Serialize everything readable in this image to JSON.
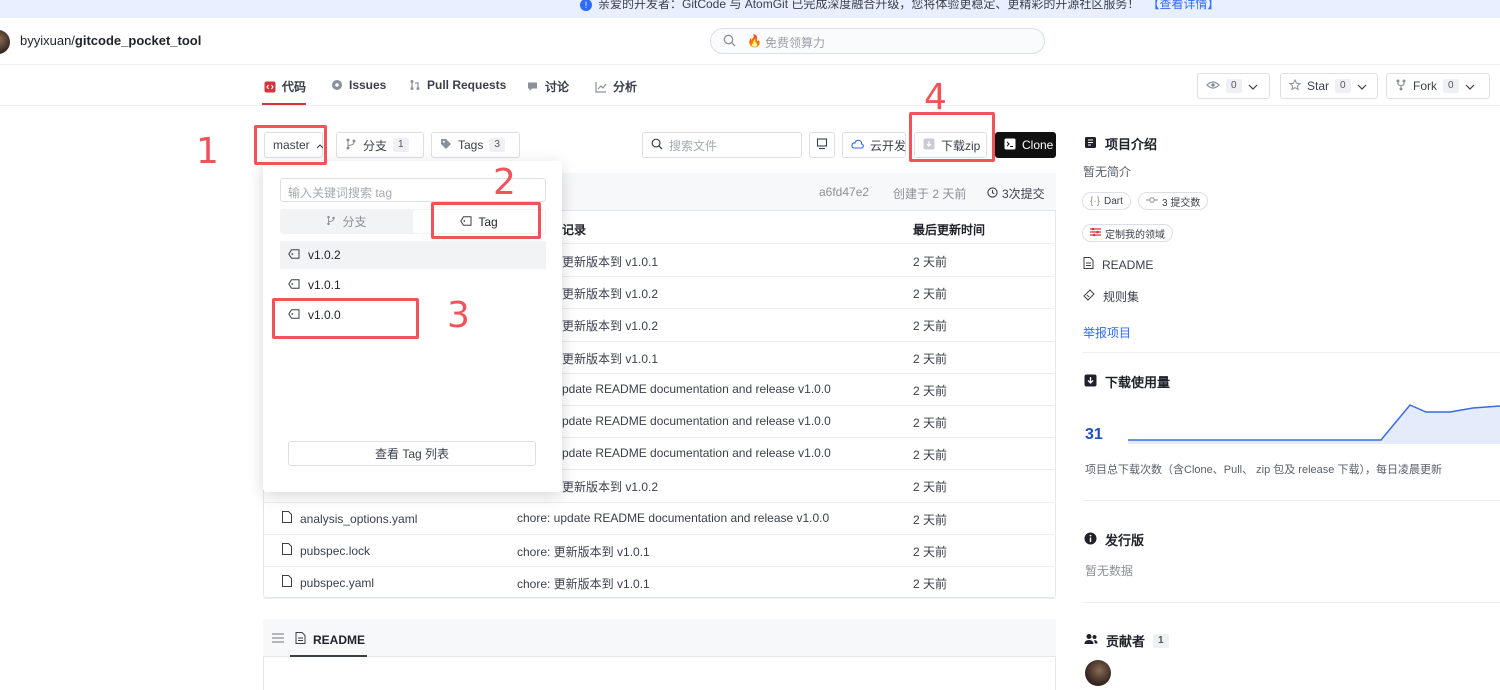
{
  "banner": {
    "text": "亲爱的开发者：GitCode 与 AtomGit 已完成深度融合升级，您将体验更稳定、更精彩的开源社区服务！",
    "link": "【查看详情】"
  },
  "header": {
    "owner": "byyixuan/",
    "repo": "gitcode_pocket_tool",
    "search_placeholder": "免费领算力"
  },
  "tabs": [
    {
      "label": "代码"
    },
    {
      "label": "Issues"
    },
    {
      "label": "Pull Requests"
    },
    {
      "label": "讨论"
    },
    {
      "label": "分析"
    }
  ],
  "repo_actions": {
    "watch_count": "0",
    "star_label": "Star",
    "star_count": "0",
    "fork_label": "Fork",
    "fork_count": "0"
  },
  "toolbar": {
    "branch": "master",
    "branches_label": "分支",
    "branches_count": "1",
    "tags_label": "Tags",
    "tags_count": "3",
    "file_search_placeholder": "搜索文件",
    "cloud_dev_label": "云开发",
    "download_zip_label": "下载zip",
    "clone_label": "Clone"
  },
  "commit_info": {
    "hash": "a6fd47e2",
    "created": "创建于 2 天前",
    "commits": "3次提交"
  },
  "table": {
    "col_commit": "记录",
    "col_updated": "最后更新时间",
    "rows": [
      {
        "name": "",
        "commit": "更新版本到 v1.0.1",
        "time": "2 天前"
      },
      {
        "name": "",
        "commit": "更新版本到 v1.0.2",
        "time": "2 天前"
      },
      {
        "name": "",
        "commit": "更新版本到 v1.0.2",
        "time": "2 天前"
      },
      {
        "name": "",
        "commit": "更新版本到 v1.0.1",
        "time": "2 天前"
      },
      {
        "name": "",
        "commit": "pdate README documentation and release v1.0.0",
        "time": "2 天前"
      },
      {
        "name": "",
        "commit": "pdate README documentation and release v1.0.0",
        "time": "2 天前"
      },
      {
        "name": "",
        "commit": "pdate README documentation and release v1.0.0",
        "time": "2 天前"
      },
      {
        "name": "",
        "commit": "更新版本到 v1.0.2",
        "time": "2 天前"
      },
      {
        "name": "analysis_options.yaml",
        "commit": "chore: update README documentation and release v1.0.0",
        "time": "2 天前"
      },
      {
        "name": "pubspec.lock",
        "commit": "chore: 更新版本到 v1.0.1",
        "time": "2 天前"
      },
      {
        "name": "pubspec.yaml",
        "commit": "chore: 更新版本到 v1.0.1",
        "time": "2 天前"
      }
    ]
  },
  "dropdown": {
    "search_placeholder": "输入关键词搜索 tag",
    "branch_tab": "分支",
    "tag_tab": "Tag",
    "tags": [
      "v1.0.2",
      "v1.0.1",
      "v1.0.0"
    ],
    "footer": "查看 Tag 列表"
  },
  "annotations": {
    "n1": "1",
    "n2": "2",
    "n3": "3",
    "n4": "4",
    "color": "#f0545a"
  },
  "readme": {
    "label": "README"
  },
  "sidebar": {
    "intro_title": "项目介绍",
    "intro_text": "暂无简介",
    "chip_lang": "Dart",
    "chip_commits": "3 提交数",
    "chip_domain": "定制我的领域",
    "readme_link": "README",
    "rules_link": "规则集",
    "report_link": "举报项目",
    "downloads_title": "下载使用量",
    "downloads_count": "31",
    "downloads_note": "项目总下载次数（含Clone、Pull、 zip 包及 release 下载），每日凌晨更新",
    "releases_title": "发行版",
    "releases_text": "暂无数据",
    "contributors_title": "贡献者",
    "contributors_count": "1"
  },
  "colors": {
    "accent_red": "#d9303d",
    "link_blue": "#2f6bff",
    "chart_line": "#3b6be0"
  }
}
